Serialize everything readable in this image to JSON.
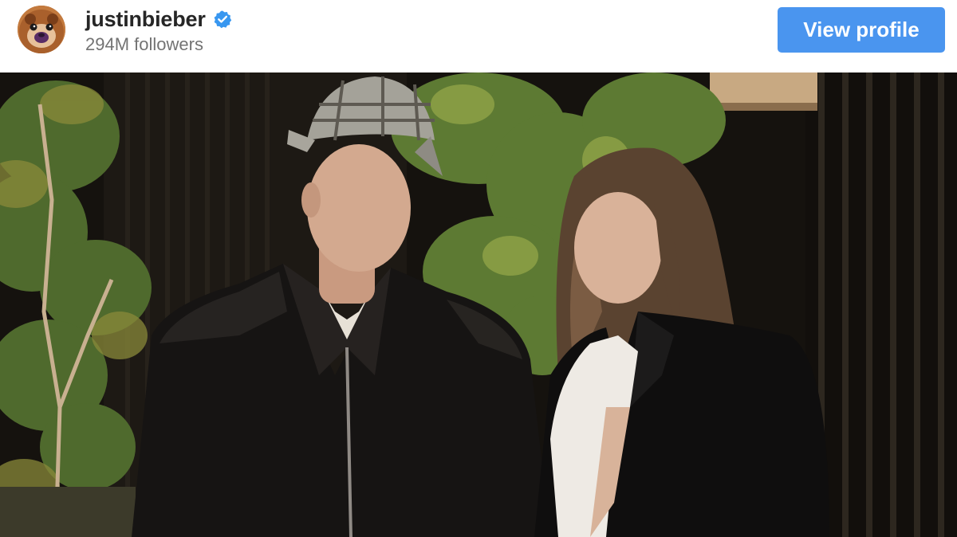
{
  "post_header": {
    "username": "justinbieber",
    "verified": true,
    "followers": "294M followers",
    "avatar_icon": "bear-avatar-icon",
    "verified_icon": "verified-badge-icon"
  },
  "actions": {
    "view_profile_label": "View profile"
  },
  "colors": {
    "button_bg": "#4a95ef",
    "username": "#262626",
    "followers": "#737373",
    "verified_badge": "#3897f0"
  }
}
